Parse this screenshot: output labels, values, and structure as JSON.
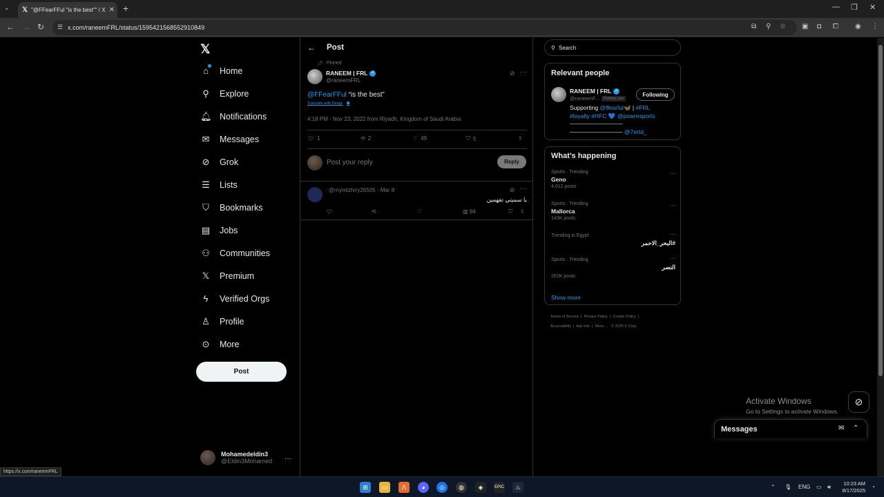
{
  "browser": {
    "tab_title": "\"@FFearFFul \"is the best\"\" / X",
    "tab_icon": "x-logo",
    "url": "x.com/raneemFRL/status/1595421568552910849",
    "status_link": "https://x.com/raneemFRL"
  },
  "nav": {
    "items": [
      {
        "label": "Home",
        "icon": "home-icon"
      },
      {
        "label": "Explore",
        "icon": "search-icon"
      },
      {
        "label": "Notifications",
        "icon": "bell-icon"
      },
      {
        "label": "Messages",
        "icon": "mail-icon"
      },
      {
        "label": "Grok",
        "icon": "grok-icon"
      },
      {
        "label": "Lists",
        "icon": "list-icon"
      },
      {
        "label": "Bookmarks",
        "icon": "bookmark-icon"
      },
      {
        "label": "Jobs",
        "icon": "briefcase-icon"
      },
      {
        "label": "Communities",
        "icon": "people-icon"
      },
      {
        "label": "Premium",
        "icon": "x-icon"
      },
      {
        "label": "Verified Orgs",
        "icon": "lightning-icon"
      },
      {
        "label": "Profile",
        "icon": "person-icon"
      },
      {
        "label": "More",
        "icon": "more-circle-icon"
      }
    ],
    "post_label": "Post",
    "account": {
      "name": "Mohamedeldin3",
      "handle": "@Eldin3Mohamed"
    }
  },
  "main": {
    "header_title": "Post",
    "pinned_label": "Pinned",
    "post": {
      "author": "RANEEM | FRL",
      "handle": "@raneemFRL",
      "mention": "@FFearFFul",
      "text": " “is the best”",
      "translate": "Translate with DeepL",
      "meta": "4:18 PM · Nov 23, 2022 from Riyadh, Kingdom of Saudi Arabia",
      "replies": "1",
      "reposts": "2",
      "likes": "49",
      "bookmarks": "5"
    },
    "reply_placeholder": "Post your reply",
    "reply_button": "Reply",
    "reply": {
      "handle": "@rnymlzhrry26505 · Mar 8",
      "text": "يا سميتي تفهمين",
      "views": "94"
    }
  },
  "right": {
    "search_placeholder": "Search",
    "relevant": {
      "title": "Relevant people",
      "name": "RANEEM | FRL",
      "handle": "@raneemF...",
      "follows_you": "Follows you",
      "button": "Following",
      "bio_prefix": "Supporting ",
      "bio_link1": "@ffearful",
      "bio_mid": "🦋 | ",
      "bio_link2": "#FRL",
      "bio_link3": "#loyalty #HFC",
      "bio_heart": " 💙 ",
      "bio_link4": "@powresports",
      "bio_line": "—————————",
      "bio_link5": "@7ertd_"
    },
    "happening": {
      "title": "What’s happening",
      "trends": [
        {
          "category": "Sports · Trending",
          "name": "Geno",
          "count": "4,012 posts"
        },
        {
          "category": "Sports · Trending",
          "name": "Mallorca",
          "count": "143K posts"
        },
        {
          "category": "Trending in Egypt",
          "name": "#البحر_الاحمر",
          "count": ""
        },
        {
          "category": "Sports · Trending",
          "name": "النصر",
          "count": "262K posts"
        }
      ],
      "show_more": "Show more"
    },
    "footer": {
      "terms": "Terms of Service",
      "privacy": "Privacy Policy",
      "cookie": "Cookie Policy",
      "accessibility": "Accessibility",
      "ads": "Ads info",
      "more": "More ...",
      "copyright": "© 2025 X Corp."
    }
  },
  "overlay": {
    "activate_title": "Activate Windows",
    "activate_sub": "Go to Settings to activate Windows.",
    "messages_drawer": "Messages"
  },
  "taskbar": {
    "lang": "ENG",
    "time": "10:23 AM",
    "date": "8/17/2025"
  }
}
